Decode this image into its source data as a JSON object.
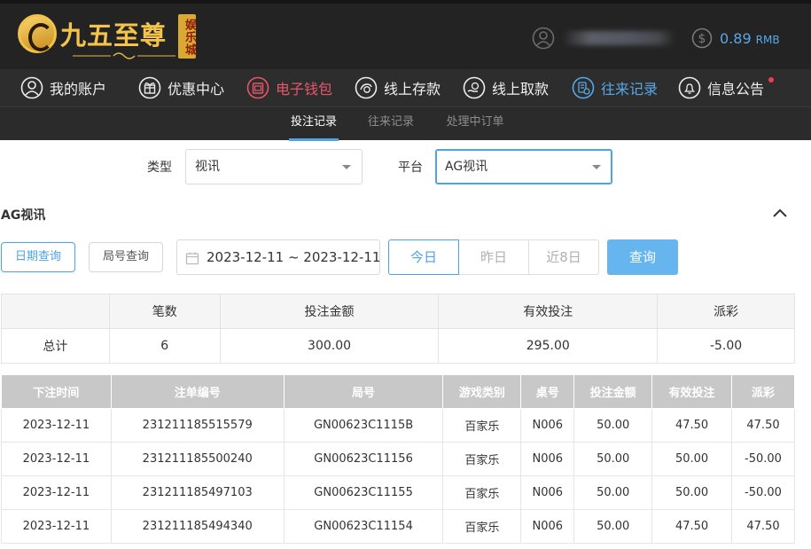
{
  "brand": {
    "name": "九五至尊",
    "badge": "娱乐城",
    "logo_color": "#f3c34b"
  },
  "account": {
    "balance": "0.89",
    "currency": "RMB"
  },
  "nav": {
    "items": [
      {
        "label": "我的账户",
        "icon": "user-icon"
      },
      {
        "label": "优惠中心",
        "icon": "gift-icon"
      },
      {
        "label": "电子钱包",
        "icon": "wallet-icon"
      },
      {
        "label": "线上存款",
        "icon": "deposit-icon"
      },
      {
        "label": "线上取款",
        "icon": "withdraw-icon"
      },
      {
        "label": "往来记录",
        "icon": "records-icon"
      },
      {
        "label": "信息公告",
        "icon": "bell-icon"
      }
    ]
  },
  "subtabs": [
    "投注记录",
    "往来记录",
    "处理中订单"
  ],
  "filters": {
    "type_label": "类型",
    "type_value": "视讯",
    "platform_label": "平台",
    "platform_value": "AG视讯"
  },
  "section": {
    "title": "AG视讯"
  },
  "query": {
    "mode_date": "日期查询",
    "mode_round": "局号查询",
    "date_range": "2023-12-11 ~ 2023-12-11",
    "quick": [
      "今日",
      "昨日",
      "近8日"
    ],
    "submit": "查询"
  },
  "summary": {
    "headers": [
      "",
      "笔数",
      "投注金额",
      "有效投注",
      "派彩"
    ],
    "row": {
      "label": "总计",
      "count": "6",
      "bet": "300.00",
      "valid": "295.00",
      "payout": "-5.00"
    }
  },
  "detail": {
    "headers": [
      "下注时间",
      "注单编号",
      "局号",
      "游戏类别",
      "桌号",
      "投注金额",
      "有效投注",
      "派彩"
    ],
    "rows": [
      {
        "time": "2023-12-11",
        "order": "231211185515579",
        "round": "GN00623C1115B",
        "game": "百家乐",
        "table": "N006",
        "bet": "50.00",
        "valid": "47.50",
        "payout": "47.50"
      },
      {
        "time": "2023-12-11",
        "order": "231211185500240",
        "round": "GN00623C11156",
        "game": "百家乐",
        "table": "N006",
        "bet": "50.00",
        "valid": "50.00",
        "payout": "-50.00"
      },
      {
        "time": "2023-12-11",
        "order": "231211185497103",
        "round": "GN00623C11155",
        "game": "百家乐",
        "table": "N006",
        "bet": "50.00",
        "valid": "50.00",
        "payout": "-50.00"
      },
      {
        "time": "2023-12-11",
        "order": "231211185494340",
        "round": "GN00623C11154",
        "game": "百家乐",
        "table": "N006",
        "bet": "50.00",
        "valid": "47.50",
        "payout": "47.50"
      }
    ]
  },
  "colors": {
    "accent": "#4da3e6",
    "negative": "#e53e4c",
    "nav_wallet": "#e8566b"
  }
}
